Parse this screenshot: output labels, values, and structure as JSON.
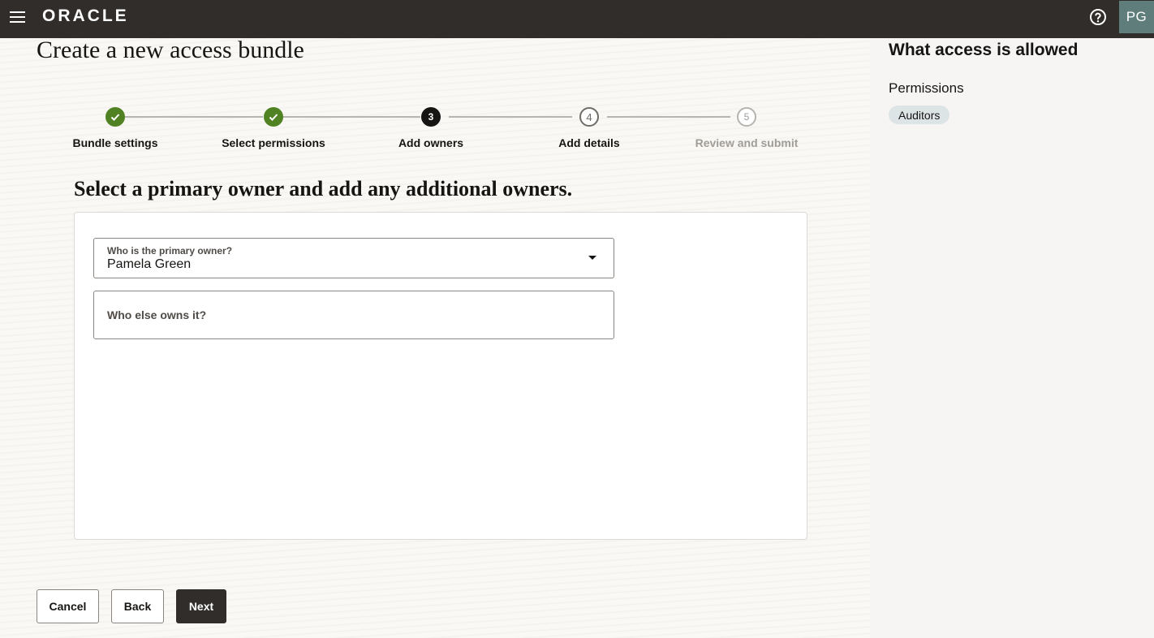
{
  "header": {
    "logo_text": "ORACLE",
    "help_icon": "help-circle-icon",
    "menu_icon": "hamburger-menu-icon",
    "avatar_initials": "PG"
  },
  "page": {
    "title": "Create a new access bundle"
  },
  "train": {
    "steps": [
      {
        "label": "Bundle settings",
        "state": "done",
        "marker": ""
      },
      {
        "label": "Select permissions",
        "state": "done",
        "marker": ""
      },
      {
        "label": "Add owners",
        "state": "current",
        "marker": "3"
      },
      {
        "label": "Add details",
        "state": "future",
        "marker": "4"
      },
      {
        "label": "Review and submit",
        "state": "disabled",
        "marker": "5"
      }
    ]
  },
  "form": {
    "section_title": "Select a primary owner and add any additional owners.",
    "primary_owner": {
      "label": "Who is the primary owner?",
      "value": "Pamela Green"
    },
    "additional_owners": {
      "placeholder": "Who else owns it?"
    }
  },
  "footer": {
    "cancel_label": "Cancel",
    "back_label": "Back",
    "next_label": "Next"
  },
  "side_panel": {
    "title": "What access is allowed",
    "permissions_label": "Permissions",
    "chips": [
      "Auditors"
    ]
  },
  "colors": {
    "header_bg": "#312d2a",
    "done_step": "#508223",
    "primary_button": "#312d2a",
    "chip_bg": "#dde4e6"
  }
}
